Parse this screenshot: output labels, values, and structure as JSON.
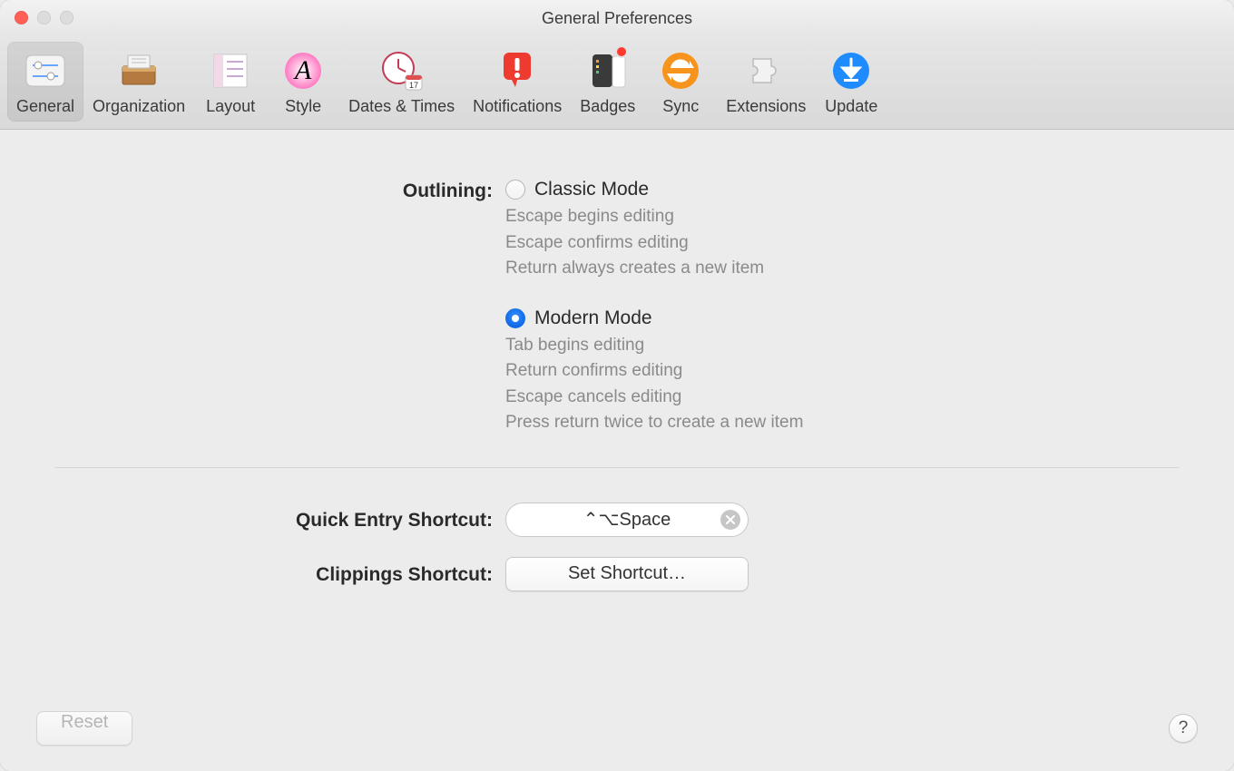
{
  "window": {
    "title": "General Preferences"
  },
  "toolbar": {
    "tabs": [
      {
        "id": "general",
        "label": "General",
        "active": true
      },
      {
        "id": "organization",
        "label": "Organization",
        "active": false
      },
      {
        "id": "layout",
        "label": "Layout",
        "active": false
      },
      {
        "id": "style",
        "label": "Style",
        "active": false
      },
      {
        "id": "dates-times",
        "label": "Dates & Times",
        "active": false
      },
      {
        "id": "notifications",
        "label": "Notifications",
        "active": false
      },
      {
        "id": "badges",
        "label": "Badges",
        "active": false
      },
      {
        "id": "sync",
        "label": "Sync",
        "active": false
      },
      {
        "id": "extensions",
        "label": "Extensions",
        "active": false
      },
      {
        "id": "update",
        "label": "Update",
        "active": false
      }
    ]
  },
  "outlining": {
    "heading": "Outlining:",
    "options": [
      {
        "id": "classic",
        "title": "Classic Mode",
        "selected": false,
        "lines": [
          "Escape begins editing",
          "Escape confirms editing",
          "Return always creates a new item"
        ]
      },
      {
        "id": "modern",
        "title": "Modern Mode",
        "selected": true,
        "lines": [
          "Tab begins editing",
          "Return confirms editing",
          "Escape cancels editing",
          "Press return twice to create a new item"
        ]
      }
    ]
  },
  "quick_entry": {
    "label": "Quick Entry Shortcut:",
    "value": "⌃⌥Space"
  },
  "clippings": {
    "label": "Clippings Shortcut:",
    "button": "Set Shortcut…"
  },
  "footer": {
    "reset": "Reset",
    "help": "?"
  }
}
